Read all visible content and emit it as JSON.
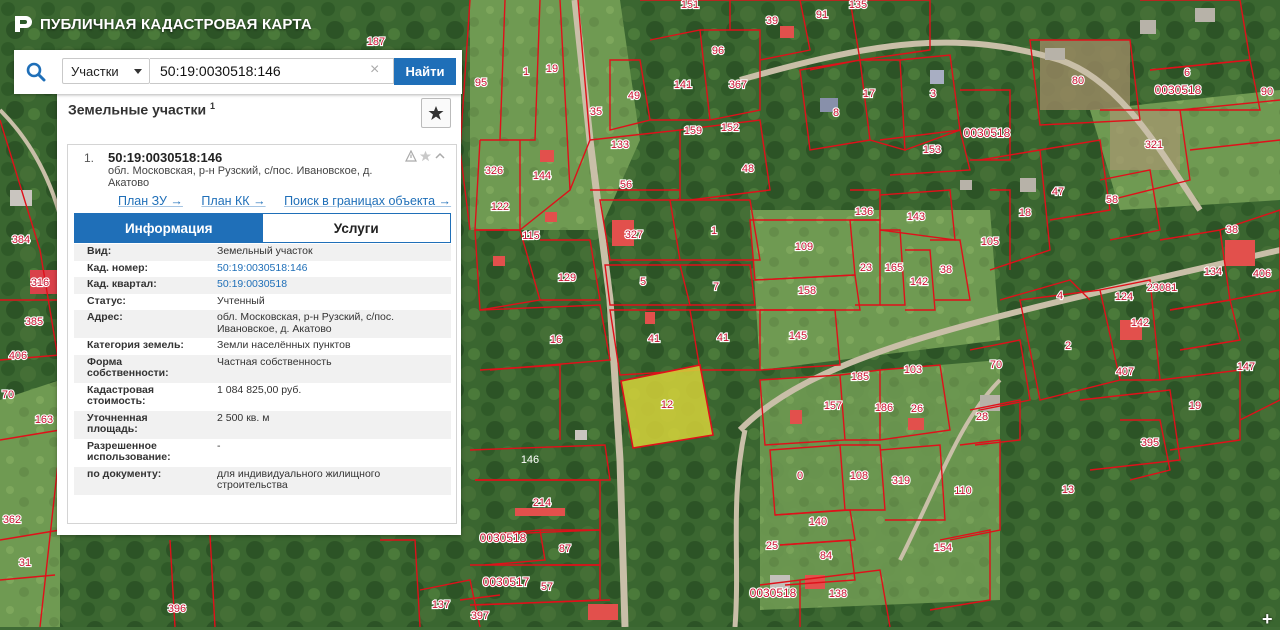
{
  "app": {
    "title": "ПУБЛИЧНАЯ КАДАСТРОВАЯ КАРТА"
  },
  "search": {
    "type_label": "Участки",
    "query": "50:19:0030518:146",
    "clear": "×",
    "find_label": "Найти"
  },
  "panel": {
    "section_title": "Земельные участки",
    "section_count": "1",
    "item": {
      "index": "1.",
      "number": "50:19:0030518:146",
      "address_short": "обл. Московская, р-н Рузский, с/пос. Ивановское, д. Акатово",
      "links": [
        "План ЗУ →",
        "План КК →",
        "Поиск в границах объекта →"
      ]
    },
    "tabs": [
      "Информация",
      "Услуги"
    ],
    "info": [
      {
        "key": "Вид:",
        "value": "Земельный участок",
        "link": false
      },
      {
        "key": "Кад. номер:",
        "value": "50:19:0030518:146",
        "link": true
      },
      {
        "key": "Кад. квартал:",
        "value": "50:19:0030518",
        "link": true
      },
      {
        "key": "Статус:",
        "value": "Учтенный",
        "link": false
      },
      {
        "key": "Адрес:",
        "value": "обл. Московская, р-н Рузский, с/пос. Ивановское, д. Акатово",
        "link": false
      },
      {
        "key": "Категория земель:",
        "value": "Земли населённых пунктов",
        "link": false
      },
      {
        "key": "Форма собственности:",
        "value": "Частная собственность",
        "link": false
      },
      {
        "key": "Кадастровая стоимость:",
        "value": "1 084 825,00 руб.",
        "link": false
      },
      {
        "key": "Уточненная площадь:",
        "value": "2 500 кв. м",
        "link": false
      },
      {
        "key": "Разрешенное использование:",
        "value": "-",
        "link": false
      },
      {
        "key": "по документу:",
        "value": "для индивидуального жилищного строительства",
        "link": false
      }
    ]
  },
  "map": {
    "selected_parcel": "146",
    "parcel_labels": [
      "151",
      "39",
      "91",
      "135",
      "187",
      "95",
      "1",
      "19",
      "96",
      "141",
      "367",
      "8",
      "17",
      "3",
      "80",
      "0030518",
      "6",
      "90",
      "35",
      "49",
      "159",
      "152",
      "0030518",
      "321",
      "133",
      "48",
      "153",
      "326",
      "144",
      "56",
      "47",
      "18",
      "58",
      "122",
      "115",
      "327",
      "1",
      "136",
      "143",
      "105",
      "109",
      "23",
      "165",
      "38",
      "38",
      "134",
      "384",
      "129",
      "5",
      "7",
      "158",
      "142",
      "4",
      "124",
      "23081",
      "406",
      "316",
      "385",
      "41",
      "41",
      "145",
      "142",
      "2",
      "407",
      "147",
      "406",
      "16",
      "185",
      "103",
      "70",
      "70",
      "157",
      "186",
      "26",
      "28",
      "19",
      "12",
      "163",
      "146",
      "0",
      "108",
      "319",
      "395",
      "362",
      "214",
      "140",
      "110",
      "13",
      "0030518",
      "87",
      "25",
      "84",
      "154",
      "31",
      "0030517",
      "57",
      "0030518",
      "138",
      "137",
      "397",
      "396",
      "247"
    ],
    "colors": {
      "boundary": "#e0101a",
      "selected_fill": "#d6d23a",
      "panel_accent": "#1f6fb8"
    },
    "zoom_label": "+"
  }
}
